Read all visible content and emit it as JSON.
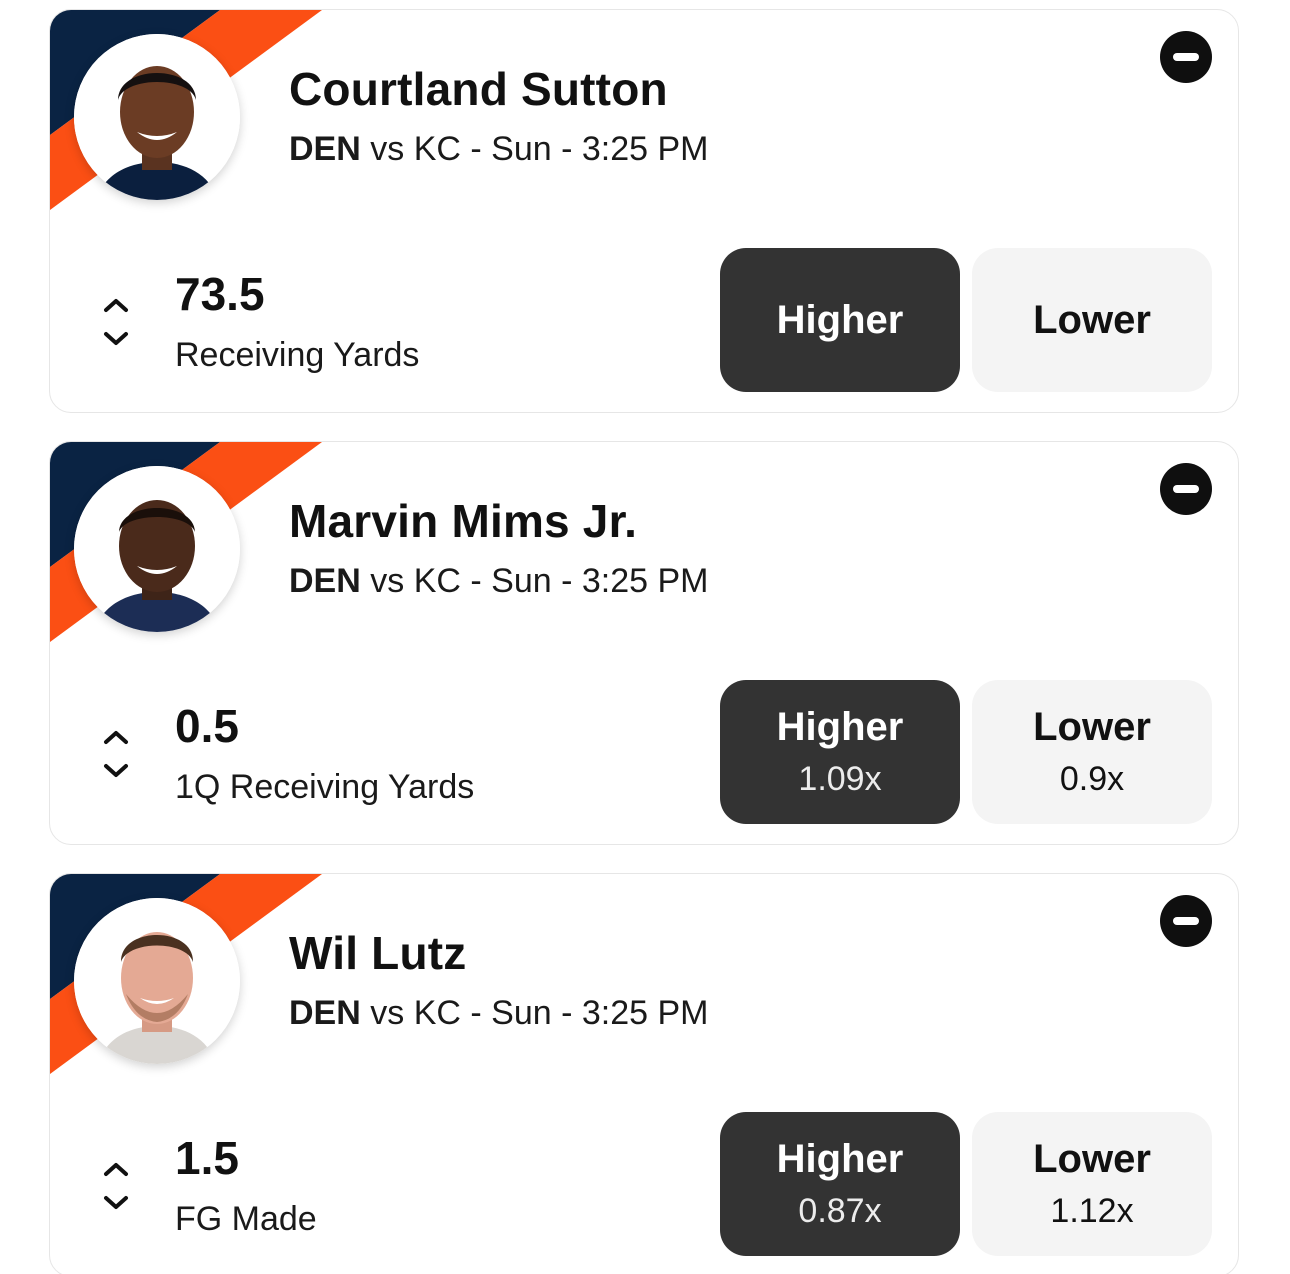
{
  "colors": {
    "team_navy": "#0a2343",
    "team_orange": "#fb4f14",
    "higher_bg": "#333333",
    "lower_bg": "#f4f4f4"
  },
  "cards": [
    {
      "player": "Courtland Sutton",
      "team": "DEN",
      "matchup_rest": " vs KC - Sun - 3:25 PM",
      "line": "73.5",
      "stat": "Receiving Yards",
      "higher": {
        "label": "Higher",
        "multiplier": ""
      },
      "lower": {
        "label": "Lower",
        "multiplier": ""
      },
      "icons": {
        "remove": "remove-icon",
        "toggle": "up-down-chevron-icon"
      }
    },
    {
      "player": "Marvin Mims Jr.",
      "team": "DEN",
      "matchup_rest": " vs KC - Sun - 3:25 PM",
      "line": "0.5",
      "stat": "1Q Receiving Yards",
      "higher": {
        "label": "Higher",
        "multiplier": "1.09x"
      },
      "lower": {
        "label": "Lower",
        "multiplier": "0.9x"
      },
      "icons": {
        "remove": "remove-icon",
        "toggle": "up-down-chevron-icon"
      }
    },
    {
      "player": "Wil Lutz",
      "team": "DEN",
      "matchup_rest": " vs KC - Sun - 3:25 PM",
      "line": "1.5",
      "stat": "FG Made",
      "higher": {
        "label": "Higher",
        "multiplier": "0.87x"
      },
      "lower": {
        "label": "Lower",
        "multiplier": "1.12x"
      },
      "icons": {
        "remove": "remove-icon",
        "toggle": "up-down-chevron-icon"
      }
    }
  ]
}
